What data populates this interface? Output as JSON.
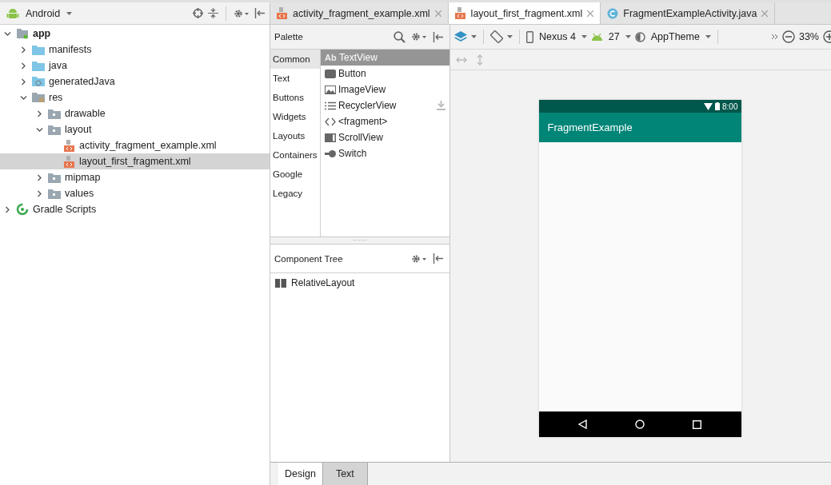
{
  "project_view": {
    "title": "Android",
    "tree": [
      {
        "label": "app",
        "kind": "module",
        "expanded": true,
        "selected": false,
        "children": [
          {
            "label": "manifests",
            "kind": "folder",
            "expanded": false,
            "selected": false
          },
          {
            "label": "java",
            "kind": "folder",
            "expanded": false,
            "selected": false
          },
          {
            "label": "generatedJava",
            "kind": "generated",
            "expanded": false,
            "selected": false
          },
          {
            "label": "res",
            "kind": "res",
            "expanded": true,
            "selected": false,
            "children": [
              {
                "label": "drawable",
                "kind": "resfolder",
                "expanded": false,
                "selected": false
              },
              {
                "label": "layout",
                "kind": "resfolder",
                "expanded": true,
                "selected": false,
                "children": [
                  {
                    "label": "activity_fragment_example.xml",
                    "kind": "xml",
                    "selected": false
                  },
                  {
                    "label": "layout_first_fragment.xml",
                    "kind": "xml",
                    "selected": true
                  }
                ]
              },
              {
                "label": "mipmap",
                "kind": "resfolder",
                "expanded": false,
                "selected": false
              },
              {
                "label": "values",
                "kind": "resfolder",
                "expanded": false,
                "selected": false
              }
            ]
          }
        ]
      },
      {
        "label": "Gradle Scripts",
        "kind": "gradle",
        "expanded": false,
        "selected": false
      }
    ]
  },
  "editor_tabs": [
    {
      "label": "activity_fragment_example.xml",
      "kind": "xml",
      "selected": false
    },
    {
      "label": "layout_first_fragment.xml",
      "kind": "xml",
      "selected": true
    },
    {
      "label": "FragmentExampleActivity.java",
      "kind": "class",
      "selected": false
    }
  ],
  "palette": {
    "title": "Palette",
    "categories": [
      {
        "label": "Common",
        "selected": true
      },
      {
        "label": "Text",
        "selected": false
      },
      {
        "label": "Buttons",
        "selected": false
      },
      {
        "label": "Widgets",
        "selected": false
      },
      {
        "label": "Layouts",
        "selected": false
      },
      {
        "label": "Containers",
        "selected": false
      },
      {
        "label": "Google",
        "selected": false
      },
      {
        "label": "Legacy",
        "selected": false
      }
    ],
    "items": [
      {
        "label": "TextView",
        "kind": "text",
        "icon_text": "Ab",
        "selected": true
      },
      {
        "label": "Button",
        "kind": "button",
        "selected": false
      },
      {
        "label": "ImageView",
        "kind": "image",
        "selected": false
      },
      {
        "label": "RecyclerView",
        "kind": "list",
        "selected": false,
        "downloadable": true
      },
      {
        "label": "<fragment>",
        "kind": "code",
        "selected": false
      },
      {
        "label": "ScrollView",
        "kind": "scroll",
        "selected": false
      },
      {
        "label": "Switch",
        "kind": "switch",
        "selected": false
      }
    ]
  },
  "design_toolbar": {
    "device": "Nexus 4",
    "api_level": "27",
    "theme": "AppTheme",
    "zoom": "33%"
  },
  "component_tree": {
    "title": "Component Tree",
    "items": [
      {
        "label": "RelativeLayout"
      }
    ]
  },
  "preview": {
    "time": "8:00",
    "app_title": "FragmentExample"
  },
  "bottom_tabs": [
    {
      "label": "Design",
      "selected": true
    },
    {
      "label": "Text",
      "selected": false
    }
  ]
}
